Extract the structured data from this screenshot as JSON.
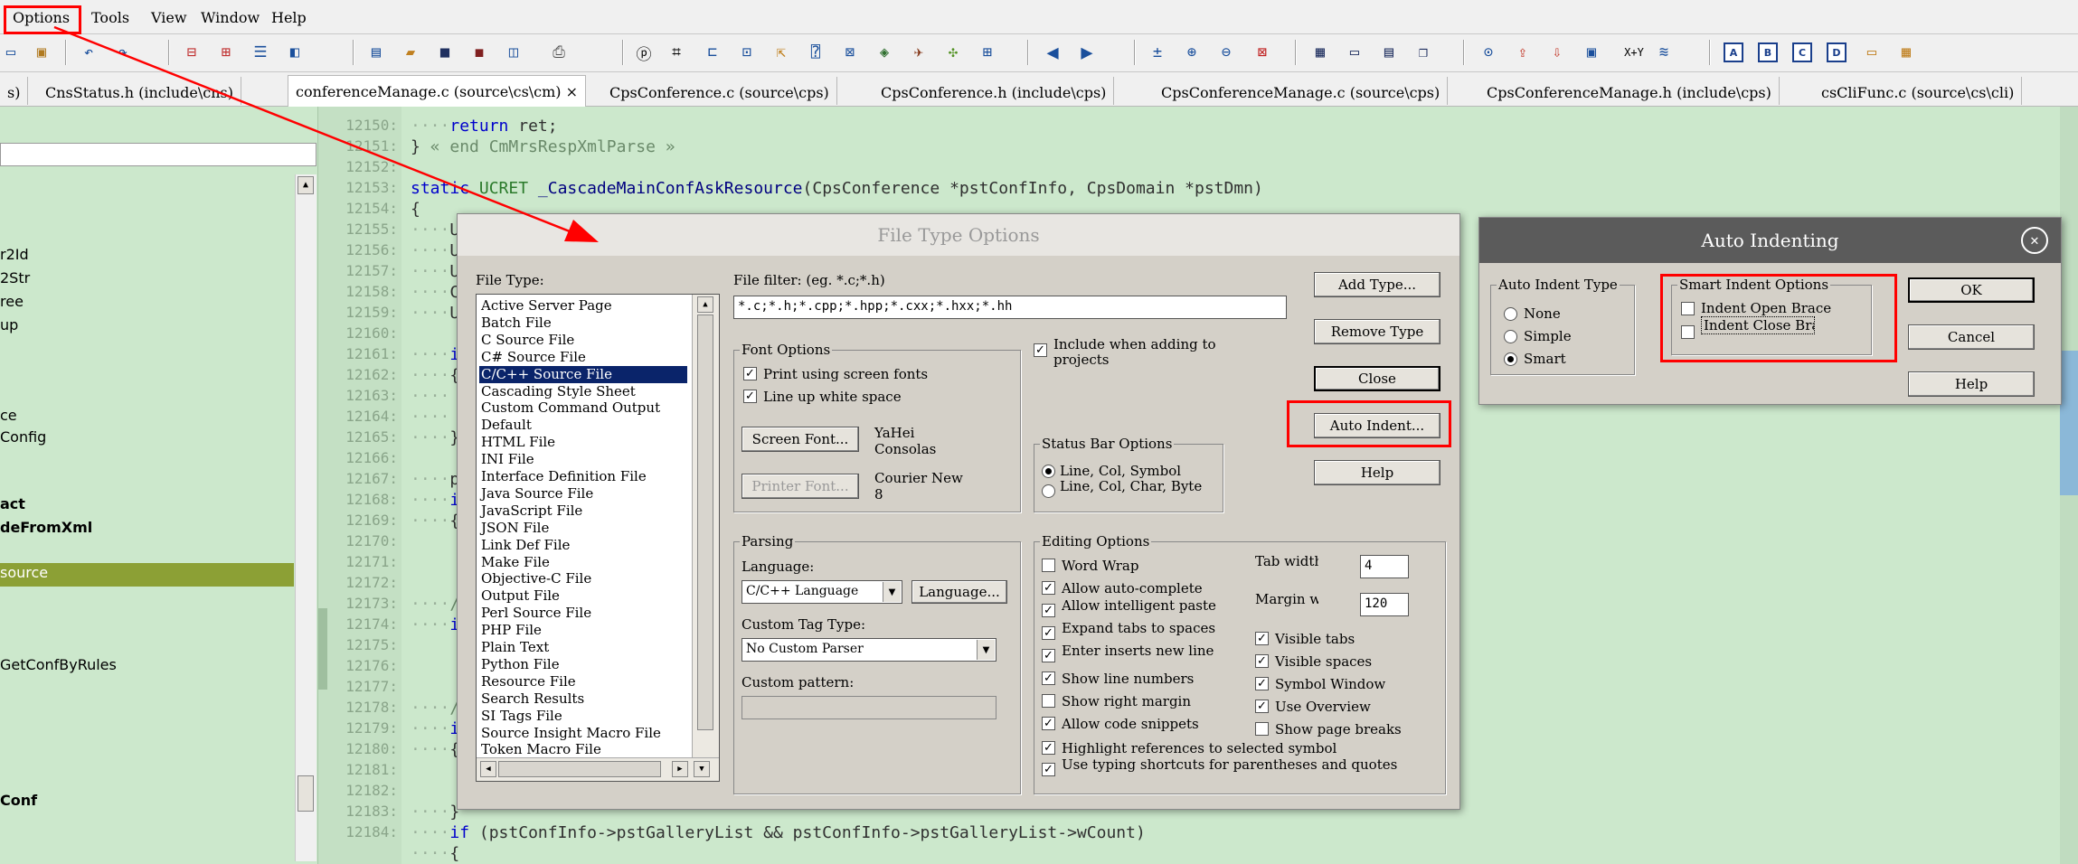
{
  "menubar": {
    "items": [
      "Options",
      "Tools",
      "View",
      "Window",
      "Help"
    ]
  },
  "toolbar": {
    "boxes": [
      "A",
      "B",
      "C",
      "D"
    ],
    "xy_label": "X+Y"
  },
  "tabs": [
    {
      "label": "s)"
    },
    {
      "label": "CnsStatus.h (include\\cns)"
    },
    {
      "label": "conferenceManage.c (source\\cs\\cm)",
      "close": "×"
    },
    {
      "label": "CpsConference.c (source\\cps)"
    },
    {
      "label": "CpsConference.h (include\\cps)"
    },
    {
      "label": "CpsConferenceManage.c (source\\cps)"
    },
    {
      "label": "CpsConferenceManage.h (include\\cps)"
    },
    {
      "label": "csCliFunc.c (source\\cs\\cli)"
    }
  ],
  "left_panel": {
    "items": [
      "r2Id",
      "2Str",
      "ree",
      "up",
      "ce",
      "Config",
      "act",
      "deFromXml",
      "source",
      "GetConfByRules",
      "Conf"
    ]
  },
  "code": {
    "line_numbers": [
      "12150:",
      "12151:",
      "12152:",
      "12153:",
      "12154:",
      "12155:",
      "12156:",
      "12157:",
      "12158:",
      "12159:",
      "12160:",
      "12161:",
      "12162:",
      "12163:",
      "12164:",
      "12165:",
      "12166:",
      "12167:",
      "12168:",
      "12169:",
      "12170:",
      "12171:",
      "12172:",
      "12173:",
      "12174:",
      "12175:",
      "12176:",
      "12177:",
      "12178:",
      "12179:",
      "12180:",
      "12181:",
      "12182:",
      "12183:",
      "12184:"
    ],
    "line_12150_kw": "return",
    "line_12150_rest": " ret;",
    "line_12151_brace": "}",
    "line_12151_comment": " « end CmMrsRespXmlParse »",
    "line_12153_static": "static",
    "line_12153_type": "UCRET",
    "line_12153_fn": "_CascadeMainConfAskResource",
    "line_12153_args": "(CpsConference *pstConfInfo, CpsDomain *pstDmn)",
    "line_12154": "{",
    "fragments": {
      "u": "U",
      "c": "C",
      "i": "i",
      "brace_open": "{",
      "brace_close": "}",
      "p": "p",
      "slash": "/"
    },
    "line_12183_kw": "if",
    "line_12183_rest": " (pstConfInfo->pstGalleryList && pstConfInfo->pstGalleryList->wCount)",
    "line_12184": "{"
  },
  "file_type_dialog": {
    "title": "File Type Options",
    "file_type_label": "File Type:",
    "file_types": [
      "Active Server Page",
      "Batch File",
      "C Source File",
      "C# Source File",
      "C/C++ Source File",
      "Cascading Style Sheet",
      "Custom Command Output",
      "Default",
      "HTML File",
      "INI File",
      "Interface Definition File",
      "Java Source File",
      "JavaScript File",
      "JSON File",
      "Link Def File",
      "Make File",
      "Objective-C File",
      "Output File",
      "Perl Source File",
      "PHP File",
      "Plain Text",
      "Python File",
      "Resource File",
      "Search Results",
      "SI Tags File",
      "Source Insight Macro File",
      "Token Macro File"
    ],
    "selected_index": 4,
    "file_filter_label": "File filter: (eg. *.c;*.h)",
    "file_filter_value": "*.c;*.h;*.cpp;*.hpp;*.cxx;*.hxx;*.hh",
    "font_options": {
      "title": "Font Options",
      "print_screen_fonts": "Print using screen fonts",
      "line_up_white": "Line up white space",
      "screen_font_btn": "Screen Font...",
      "screen_font_1": "YaHei",
      "screen_font_2": "Consolas",
      "printer_font_btn": "Printer Font...",
      "printer_font_1": "Courier New",
      "printer_font_2": "8"
    },
    "include_when_adding": "Include when adding to projects",
    "status_bar": {
      "title": "Status Bar Options",
      "opt1": "Line, Col, Symbol",
      "opt2": "Line, Col, Char, Byte"
    },
    "parsing": {
      "title": "Parsing",
      "language_label": "Language:",
      "language_value": "C/C++ Language",
      "language_btn": "Language...",
      "custom_tag_label": "Custom Tag Type:",
      "custom_tag_value": "No Custom Parser",
      "custom_pattern_label": "Custom pattern:"
    },
    "editing": {
      "title": "Editing Options",
      "word_wrap": "Word Wrap",
      "auto_complete": "Allow auto-complete",
      "intelligent_paste": "Allow intelligent paste",
      "expand_tabs": "Expand tabs to spaces",
      "enter_inserts": "Enter inserts new line",
      "show_line_numbers": "Show line numbers",
      "show_right_margin": "Show right margin",
      "code_snippets": "Allow code snippets",
      "highlight_refs": "Highlight references to selected symbol",
      "typing_shortcuts": "Use typing shortcuts for parentheses and quotes",
      "tab_label": "Tab width",
      "tab_value": "4",
      "margin_label": "Margin width",
      "margin_value": "120",
      "visible_tabs": "Visible tabs",
      "visible_spaces": "Visible spaces",
      "symbol_window": "Symbol Window",
      "use_overview": "Use Overview",
      "show_page_breaks": "Show page breaks"
    },
    "buttons": {
      "add_type": "Add Type...",
      "remove_type": "Remove Type",
      "close": "Close",
      "auto_indent": "Auto Indent...",
      "help": "Help"
    }
  },
  "auto_indent_dialog": {
    "title": "Auto Indenting",
    "close_glyph": "✕",
    "type_group": "Auto Indent Type",
    "none": "None",
    "simple": "Simple",
    "smart": "Smart",
    "smart_group": "Smart Indent Options",
    "indent_open": "Indent Open Brace",
    "indent_close": "Indent Close Brace",
    "ok": "OK",
    "cancel": "Cancel",
    "help": "Help"
  },
  "colors": {
    "highlight": "#ff0000",
    "selection": "#0a246a",
    "tree_selection": "#8ca035",
    "editor_bg": "#cce8cc"
  },
  "icons": [
    "undo-icon",
    "redo-icon",
    "new-file-icon",
    "open-icon",
    "save-icon",
    "print-icon",
    "left-arrow-icon",
    "right-arrow-icon",
    "zoom-icon"
  ]
}
